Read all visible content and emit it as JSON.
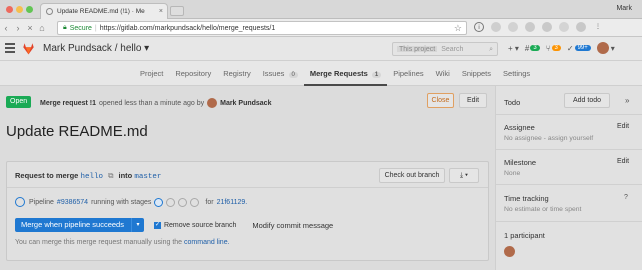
{
  "browser": {
    "tab_title": "Update README.md (!1) · Me",
    "profile_name": "Mark",
    "secure_label": "Secure",
    "url": "https://gitlab.com/markpundsack/hello/merge_requests/1"
  },
  "header": {
    "project_title": "Mark Pundsack / hello ▾",
    "search_scope": "This project",
    "search_placeholder": "Search",
    "issues_count": "3",
    "mr_count": "3",
    "todo_count": "99+",
    "plus_label": "+ ▾"
  },
  "nav": {
    "items": [
      {
        "label": "Project"
      },
      {
        "label": "Repository"
      },
      {
        "label": "Registry"
      },
      {
        "label": "Issues",
        "count": "0"
      },
      {
        "label": "Merge Requests",
        "count": "1"
      },
      {
        "label": "Pipelines"
      },
      {
        "label": "Wiki"
      },
      {
        "label": "Snippets"
      },
      {
        "label": "Settings"
      }
    ]
  },
  "mr": {
    "status": "Open",
    "ref": "Merge request !1",
    "opened_text": "opened less than a minute ago by",
    "author": "Mark Pundsack",
    "close_label": "Close",
    "edit_label": "Edit",
    "title": "Update README.md"
  },
  "widget": {
    "request_label": "Request to merge",
    "source_branch": "hello",
    "into_label": "into",
    "target_branch": "master",
    "checkout_label": "Check out branch",
    "download_label": "⤓ ▾",
    "pipeline_label": "Pipeline",
    "pipeline_id": "#9386574",
    "pipeline_status": "running with stages",
    "for_label": "for",
    "commit_sha": "21f61129.",
    "merge_button": "Merge when pipeline succeeds",
    "remove_source_label": "Remove source branch",
    "modify_commit_label": "Modify commit message",
    "manual_note": "You can merge this merge request manually using the",
    "command_line_label": "command line."
  },
  "sidebar": {
    "todo_label": "Todo",
    "add_todo_label": "Add todo",
    "assignee_label": "Assignee",
    "assignee_edit": "Edit",
    "assignee_value": "No assignee - assign yourself",
    "milestone_label": "Milestone",
    "milestone_edit": "Edit",
    "milestone_value": "None",
    "time_label": "Time tracking",
    "time_value": "No estimate or time spent",
    "participants_label": "1 participant"
  }
}
